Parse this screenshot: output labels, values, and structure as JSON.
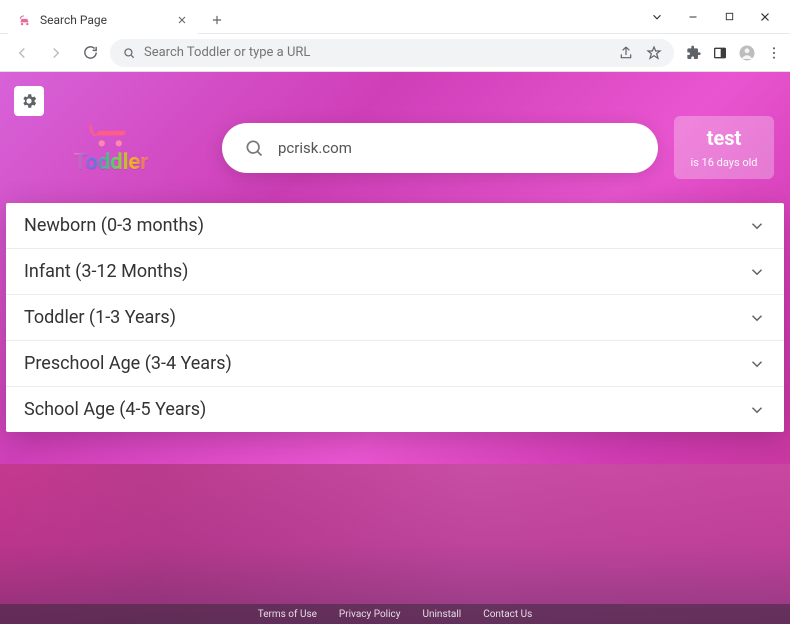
{
  "window": {
    "tab_title": "Search Page"
  },
  "toolbar": {
    "omnibox_placeholder": "Search Toddler or type a URL"
  },
  "page": {
    "logo_text": "Toddler",
    "search_value": "pcrisk.com",
    "info_card": {
      "name": "test",
      "age_line": "is 16 days old"
    },
    "categories": [
      {
        "label": "Newborn (0-3 months)"
      },
      {
        "label": "Infant (3-12 Months)"
      },
      {
        "label": "Toddler (1-3 Years)"
      },
      {
        "label": "Preschool Age (3-4 Years)"
      },
      {
        "label": "School Age (4-5 Years)"
      }
    ],
    "footer": {
      "terms": "Terms of Use",
      "privacy": "Privacy Policy",
      "uninstall": "Uninstall",
      "contact": "Contact Us"
    }
  }
}
